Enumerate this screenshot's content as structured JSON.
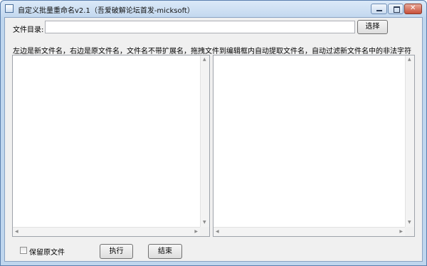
{
  "window": {
    "title": "自定义批量重命名v2.1（吾爱破解论坛首发-micksoft）"
  },
  "top_row": {
    "dir_label": "文件目录:",
    "dir_value": "",
    "select_button": "选择"
  },
  "hint": "左边是新文件名，右边是原文件名，文件名不带扩展名，拖拽文件到编辑框内自动提取文件名，自动过滤新文件名中的非法字符",
  "bottom": {
    "keep_original_label": "保留原文件",
    "keep_original_checked": false,
    "run_button": "执行",
    "end_button": "结束"
  },
  "icons": {
    "app": "window-app-icon",
    "minimize": "minimize-icon",
    "maximize": "maximize-icon",
    "close": "close-icon",
    "scroll_up": "arrow-up-icon",
    "scroll_down": "arrow-down-icon",
    "scroll_left": "arrow-left-icon",
    "scroll_right": "arrow-right-icon"
  }
}
